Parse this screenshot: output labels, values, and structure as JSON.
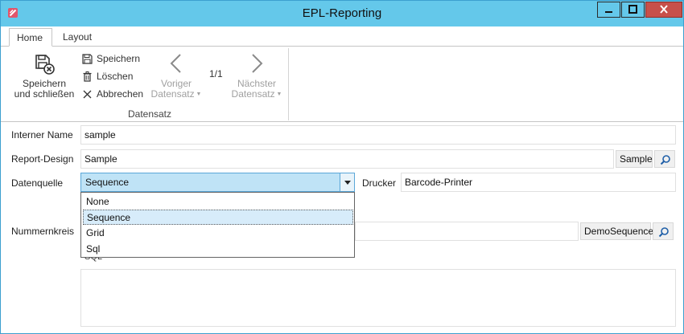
{
  "window": {
    "title": "EPL-Reporting"
  },
  "ribbon": {
    "tabs": [
      {
        "label": "Home",
        "active": true
      },
      {
        "label": "Layout",
        "active": false
      }
    ],
    "save_close_line1": "Speichern",
    "save_close_line2": "und schließen",
    "save_label": "Speichern",
    "delete_label": "Löschen",
    "cancel_label": "Abbrechen",
    "prev_line1": "Voriger",
    "prev_line2": "Datensatz",
    "counter": "1/1",
    "next_line1": "Nächster",
    "next_line2": "Datensatz",
    "group_label": "Datensatz"
  },
  "form": {
    "internal_name_label": "Interner Name",
    "internal_name_value": "sample",
    "report_design_label": "Report-Design",
    "report_design_value": "Sample",
    "report_design_button": "Sample",
    "datasource_label": "Datenquelle",
    "datasource_value": "Sequence",
    "datasource_options": [
      "None",
      "Sequence",
      "Grid",
      "Sql"
    ],
    "printer_label": "Drucker",
    "printer_value": "Barcode-Printer",
    "number_range_label": "Nummernkreis",
    "number_range_button": "DemoSequence",
    "sql_label_partial": "SQL"
  },
  "colors": {
    "titlebar": "#64c8ea",
    "close_button": "#c7504a",
    "combo_highlight": "#bfe3f6"
  }
}
